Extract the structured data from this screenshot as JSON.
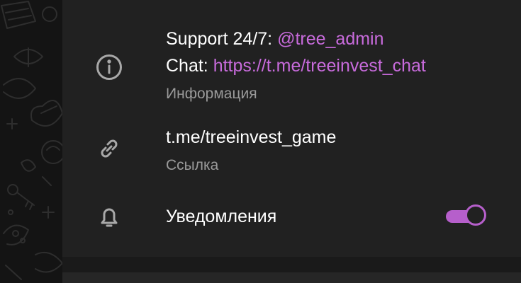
{
  "info": {
    "support_prefix": "Support 24/7: ",
    "support_handle": "@tree_admin",
    "chat_prefix": "Chat: ",
    "chat_link": "https://t.me/treeinvest_chat",
    "caption": "Информация"
  },
  "link_row": {
    "value": "t.me/treeinvest_game",
    "caption": "Ссылка"
  },
  "notifications": {
    "label": "Уведомления",
    "enabled": true
  },
  "colors": {
    "accent": "#b65fcb",
    "link": "#c86bdc",
    "panel": "#212121",
    "secondary_text": "#9a9a9a"
  },
  "icons": {
    "info": "info-circle-icon",
    "link": "link-icon",
    "notifications": "bell-icon"
  }
}
